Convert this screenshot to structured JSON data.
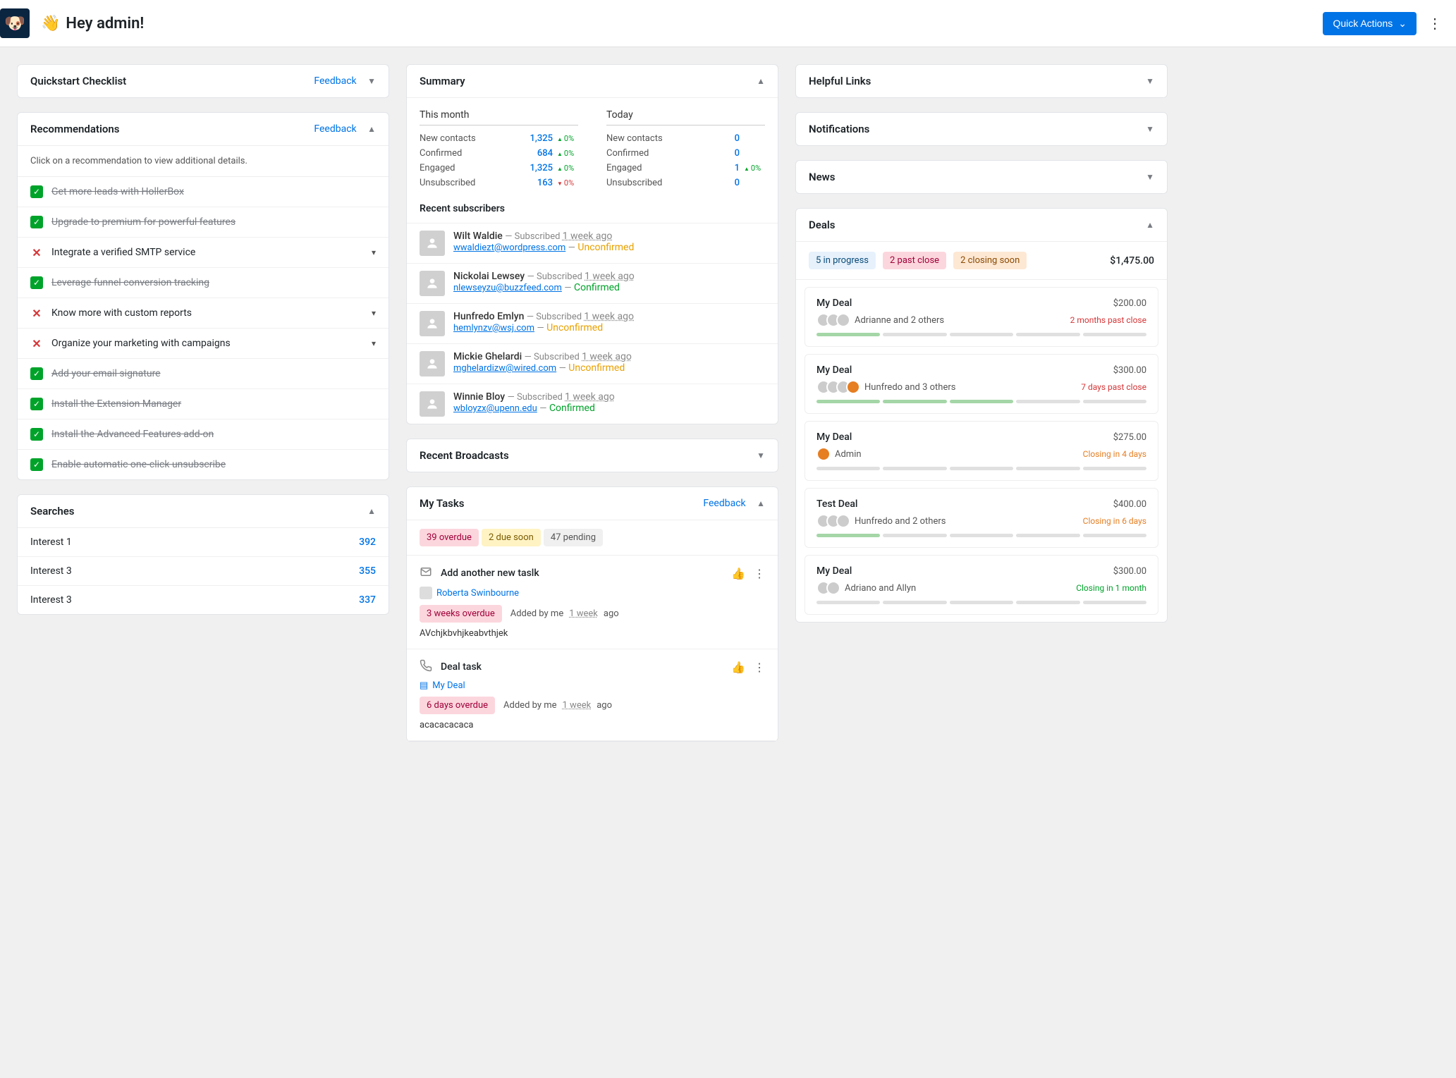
{
  "header": {
    "greeting": "Hey admin!",
    "quick_actions": "Quick Actions"
  },
  "quickstart": {
    "title": "Quickstart Checklist",
    "feedback": "Feedback"
  },
  "recommendations": {
    "title": "Recommendations",
    "feedback": "Feedback",
    "hint": "Click on a recommendation to view additional details.",
    "items": [
      {
        "label": "Get more leads with HollerBox",
        "done": true,
        "expandable": false
      },
      {
        "label": "Upgrade to premium for powerful features",
        "done": true,
        "expandable": false
      },
      {
        "label": "Integrate a verified SMTP service",
        "done": false,
        "expandable": true
      },
      {
        "label": "Leverage funnel conversion tracking",
        "done": true,
        "expandable": false
      },
      {
        "label": "Know more with custom reports",
        "done": false,
        "expandable": true
      },
      {
        "label": "Organize your marketing with campaigns",
        "done": false,
        "expandable": true
      },
      {
        "label": "Add your email signature",
        "done": true,
        "expandable": false
      },
      {
        "label": "Install the Extension Manager",
        "done": true,
        "expandable": false
      },
      {
        "label": "Install the Advanced Features add-on",
        "done": true,
        "expandable": false
      },
      {
        "label": "Enable automatic one-click unsubscribe",
        "done": true,
        "expandable": false
      }
    ]
  },
  "searches": {
    "title": "Searches",
    "items": [
      {
        "label": "Interest 1",
        "count": "392"
      },
      {
        "label": "Interest 3",
        "count": "355"
      },
      {
        "label": "Interest 3",
        "count": "337"
      }
    ]
  },
  "summary": {
    "title": "Summary",
    "this_month": {
      "title": "This month",
      "rows": [
        {
          "label": "New contacts",
          "value": "1,325",
          "delta": "0%",
          "dir": "up",
          "color": "green"
        },
        {
          "label": "Confirmed",
          "value": "684",
          "delta": "0%",
          "dir": "up",
          "color": "green"
        },
        {
          "label": "Engaged",
          "value": "1,325",
          "delta": "0%",
          "dir": "up",
          "color": "green"
        },
        {
          "label": "Unsubscribed",
          "value": "163",
          "delta": "0%",
          "dir": "down",
          "color": "red"
        }
      ]
    },
    "today": {
      "title": "Today",
      "rows": [
        {
          "label": "New contacts",
          "value": "0",
          "delta": "",
          "dir": "",
          "color": ""
        },
        {
          "label": "Confirmed",
          "value": "0",
          "delta": "",
          "dir": "",
          "color": ""
        },
        {
          "label": "Engaged",
          "value": "1",
          "delta": "0%",
          "dir": "up",
          "color": "green"
        },
        {
          "label": "Unsubscribed",
          "value": "0",
          "delta": "",
          "dir": "",
          "color": ""
        }
      ]
    },
    "recent_subs_title": "Recent subscribers",
    "subscribers": [
      {
        "name": "Wilt Waldie",
        "meta": "Subscribed",
        "time": "1 week ago",
        "email": "wwaldiezt@wordpress.com",
        "status": "Unconfirmed"
      },
      {
        "name": "Nickolai Lewsey",
        "meta": "Subscribed",
        "time": "1 week ago",
        "email": "nlewseyzu@buzzfeed.com",
        "status": "Confirmed"
      },
      {
        "name": "Hunfredo Emlyn",
        "meta": "Subscribed",
        "time": "1 week ago",
        "email": "hemlynzv@wsj.com",
        "status": "Unconfirmed"
      },
      {
        "name": "Mickie Ghelardi",
        "meta": "Subscribed",
        "time": "1 week ago",
        "email": "mghelardizw@wired.com",
        "status": "Unconfirmed"
      },
      {
        "name": "Winnie Bloy",
        "meta": "Subscribed",
        "time": "1 week ago",
        "email": "wbloyzx@upenn.edu",
        "status": "Confirmed"
      }
    ]
  },
  "broadcasts": {
    "title": "Recent Broadcasts"
  },
  "tasks": {
    "title": "My Tasks",
    "feedback": "Feedback",
    "badges": {
      "overdue": "39 overdue",
      "due_soon": "2 due soon",
      "pending": "47 pending"
    },
    "items": [
      {
        "icon": "envelope",
        "title": "Add another new taslk",
        "link_label": "Roberta Swinbourne",
        "link_icon": "avatar",
        "badge": "3 weeks overdue",
        "added_by": "Added by me",
        "added_time": "1 week",
        "added_suffix": "ago",
        "content": "AVchjkbvhjkeabvthjek"
      },
      {
        "icon": "phone",
        "title": "Deal task",
        "link_label": "My Deal",
        "link_icon": "deal",
        "badge": "6 days overdue",
        "added_by": "Added by me",
        "added_time": "1 week",
        "added_suffix": "ago",
        "content": "acacacacaca"
      }
    ]
  },
  "helpful_links": {
    "title": "Helpful Links"
  },
  "notifications": {
    "title": "Notifications"
  },
  "news": {
    "title": "News"
  },
  "deals": {
    "title": "Deals",
    "badges": {
      "in_progress": "5 in progress",
      "past_close": "2 past close",
      "closing_soon": "2 closing soon"
    },
    "total": "$1,475.00",
    "items": [
      {
        "name": "My Deal",
        "amount": "$200.00",
        "who": "Adrianne and 2 others",
        "status": "2 months past close",
        "status_class": "past",
        "avatars": [
          "g",
          "g",
          "g"
        ],
        "progress": 1
      },
      {
        "name": "My Deal",
        "amount": "$300.00",
        "who": "Hunfredo and 3 others",
        "status": "7 days past close",
        "status_class": "past",
        "avatars": [
          "g",
          "g",
          "g",
          "o"
        ],
        "progress": 3
      },
      {
        "name": "My Deal",
        "amount": "$275.00",
        "who": "Admin",
        "status": "Closing in 4 days",
        "status_class": "closing-o",
        "avatars": [
          "o"
        ],
        "progress": 0
      },
      {
        "name": "Test Deal",
        "amount": "$400.00",
        "who": "Hunfredo and 2 others",
        "status": "Closing in 6 days",
        "status_class": "closing-o",
        "avatars": [
          "g",
          "g",
          "g"
        ],
        "progress": 1
      },
      {
        "name": "My Deal",
        "amount": "$300.00",
        "who": "Adriano and Allyn",
        "status": "Closing in 1 month",
        "status_class": "closing-g",
        "avatars": [
          "g",
          "g"
        ],
        "progress": 0
      }
    ]
  }
}
